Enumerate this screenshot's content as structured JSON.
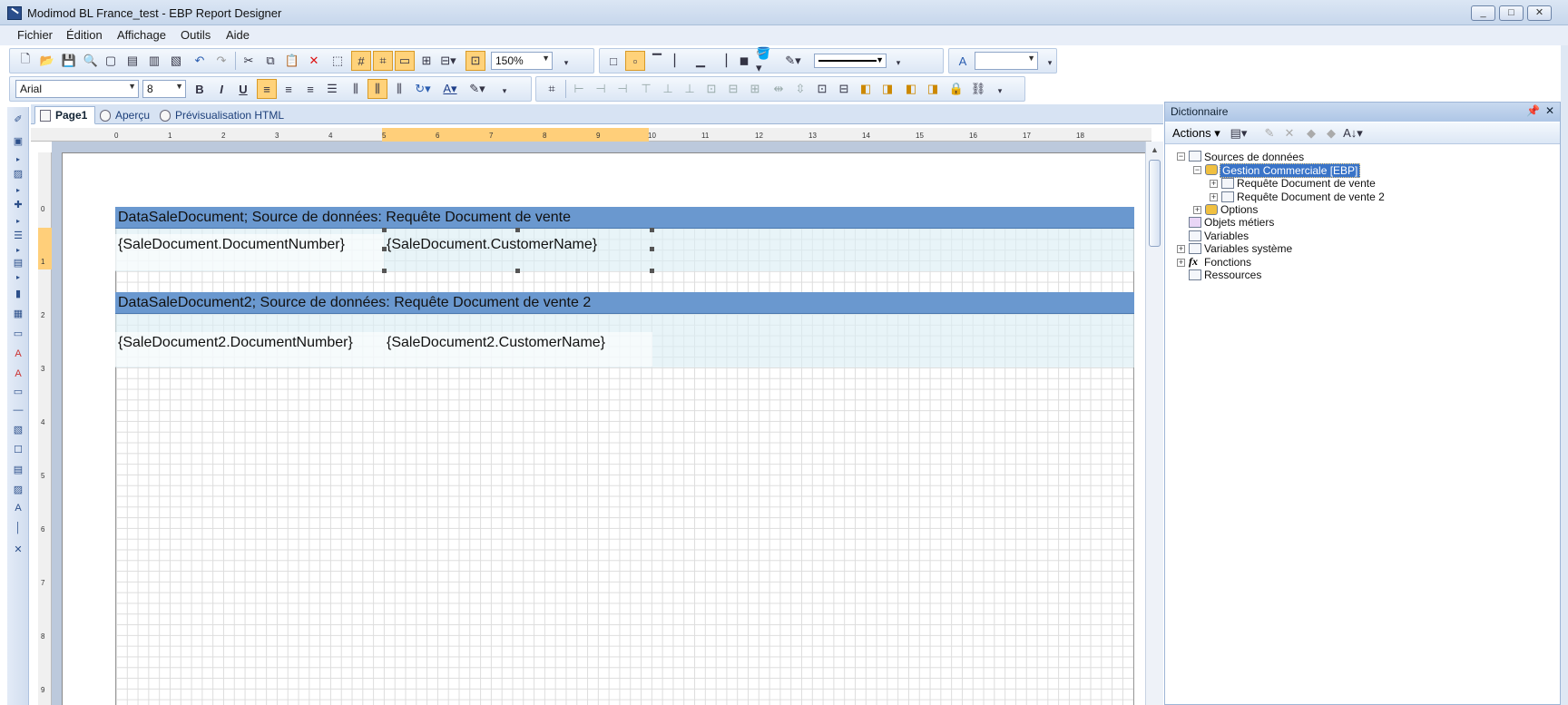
{
  "window": {
    "title": "Modimod BL France_test - EBP Report Designer"
  },
  "menu": [
    "Fichier",
    "Édition",
    "Affichage",
    "Outils",
    "Aide"
  ],
  "toolbar": {
    "zoom": "150%",
    "font_name": "Arial",
    "font_size": "8"
  },
  "tabs": [
    {
      "label": "Page1"
    },
    {
      "label": "Aperçu"
    },
    {
      "label": "Prévisualisation HTML"
    }
  ],
  "ruler": {
    "h": [
      "0",
      "1",
      "2",
      "3",
      "4",
      "5",
      "6",
      "7",
      "8",
      "9",
      "10",
      "11",
      "12",
      "13",
      "14",
      "15",
      "16",
      "17",
      "18"
    ],
    "v": [
      "0",
      "1",
      "2",
      "3",
      "4",
      "5",
      "6",
      "7",
      "8",
      "9"
    ]
  },
  "report": {
    "band1": {
      "header": "DataSaleDocument; Source de données: Requête Document de vente",
      "field1": "{SaleDocument.DocumentNumber}",
      "field2": "{SaleDocument.CustomerName}"
    },
    "band2": {
      "header": "DataSaleDocument2; Source de données: Requête Document de vente 2",
      "field1": "{SaleDocument2.DocumentNumber}",
      "field2": "{SaleDocument2.CustomerName}"
    }
  },
  "dictionary": {
    "title": "Dictionnaire",
    "actions_label": "Actions",
    "tree": {
      "sources": "Sources de données",
      "gestion": "Gestion Commerciale [EBP]",
      "req1": "Requête Document de vente",
      "req2": "Requête Document de vente 2",
      "options": "Options",
      "objets": "Objets métiers",
      "variables": "Variables",
      "varsys": "Variables système",
      "fonctions": "Fonctions",
      "ressources": "Ressources"
    }
  }
}
